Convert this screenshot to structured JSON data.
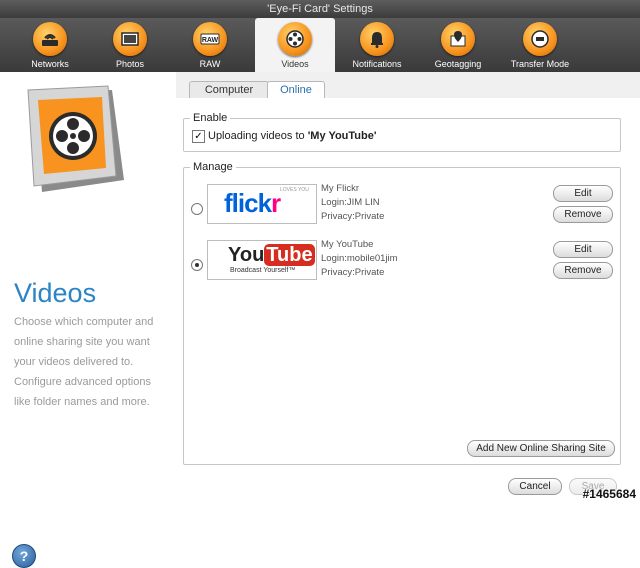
{
  "window": {
    "title": "'Eye-Fi Card' Settings"
  },
  "toolbar": {
    "items": [
      {
        "label": "Networks",
        "icon": "router-icon"
      },
      {
        "label": "Photos",
        "icon": "photos-icon"
      },
      {
        "label": "RAW",
        "icon": "raw-icon"
      },
      {
        "label": "Videos",
        "icon": "film-reel-icon"
      },
      {
        "label": "Notifications",
        "icon": "bell-icon"
      },
      {
        "label": "Geotagging",
        "icon": "map-pin-icon"
      },
      {
        "label": "Transfer Mode",
        "icon": "transfer-mode-icon"
      }
    ],
    "active": "Videos"
  },
  "left": {
    "title": "Videos",
    "description": "Choose which computer and online sharing site you want your videos delivered to. Configure advanced options like folder names and more."
  },
  "tabs": [
    {
      "label": "Computer"
    },
    {
      "label": "Online"
    }
  ],
  "enable": {
    "group_title": "Enable",
    "checkbox_label_prefix": "Uploading videos to ",
    "checkbox_label_site": "'My YouTube'",
    "checked": true
  },
  "manage": {
    "group_title": "Manage",
    "sites": [
      {
        "name": "My Flickr",
        "login": "Login:JIM LIN",
        "privacy": "Privacy:Private",
        "logo_text": "flickr",
        "logo_tag": "LOVES YOU",
        "selected": false
      },
      {
        "name": "My YouTube",
        "login": "Login:mobile01jim",
        "privacy": "Privacy:Private",
        "logo_you": "You",
        "logo_tube": "Tube",
        "logo_tag": "Broadcast Yourself™",
        "selected": true
      }
    ],
    "edit_label": "Edit",
    "remove_label": "Remove",
    "add_label": "Add New Online Sharing Site"
  },
  "footer": {
    "cancel_label": "Cancel",
    "save_label": "Save",
    "help_label": "?"
  },
  "watermark": "#1465684",
  "colors": {
    "accent": "#2a84c6",
    "toolbar_bg": "#4a4a4a",
    "icon_orange": "#f7931e"
  }
}
